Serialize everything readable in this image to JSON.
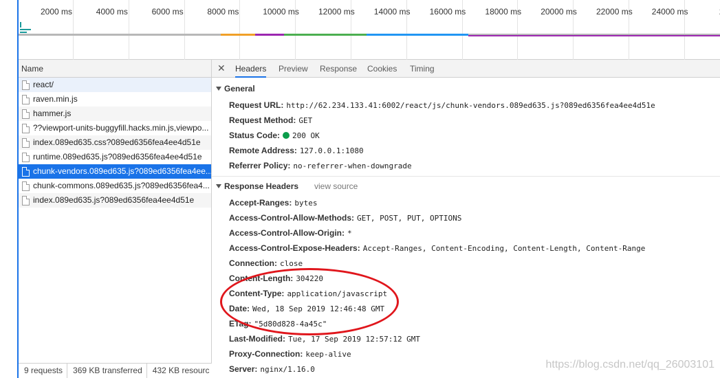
{
  "timeline": {
    "ticks": [
      "2000 ms",
      "4000 ms",
      "6000 ms",
      "8000 ms",
      "10000 ms",
      "12000 ms",
      "14000 ms",
      "16000 ms",
      "18000 ms",
      "20000 ms",
      "22000 ms",
      "24000 ms",
      "2600"
    ],
    "colors": {
      "gray": "#b8b8b8",
      "orange": "#f0a028",
      "purple": "#9c27b0",
      "green": "#4caf50",
      "blue": "#2196f3",
      "teal": "#1a9a9a"
    }
  },
  "name_panel": {
    "header": "Name",
    "rows": [
      "react/",
      "raven.min.js",
      "hammer.js",
      "??viewport-units-buggyfill.hacks.min.js,viewpo...",
      "index.089ed635.css?089ed6356fea4ee4d51e",
      "runtime.089ed635.js?089ed6356fea4ee4d51e",
      "chunk-vendors.089ed635.js?089ed6356fea4ee...",
      "chunk-commons.089ed635.js?089ed6356fea4...",
      "index.089ed635.js?089ed6356fea4ee4d51e"
    ],
    "selected_index": 6
  },
  "status": {
    "requests": "9 requests",
    "transferred": "369 KB transferred",
    "resources": "432 KB resourc"
  },
  "details": {
    "close_icon": "✕",
    "tabs": [
      "Headers",
      "Preview",
      "Response",
      "Cookies",
      "Timing"
    ],
    "active_tab": "Headers",
    "general": {
      "title": "General",
      "fields": [
        {
          "key": "Request URL:",
          "value": "http://62.234.133.41:6002/react/js/chunk-vendors.089ed635.js?089ed6356fea4ee4d51e"
        },
        {
          "key": "Request Method:",
          "value": "GET"
        },
        {
          "key": "Status Code:",
          "value": "200 OK"
        },
        {
          "key": "Remote Address:",
          "value": "127.0.0.1:1080"
        },
        {
          "key": "Referrer Policy:",
          "value": "no-referrer-when-downgrade"
        }
      ],
      "status_color": "#0a9d4b"
    },
    "response_headers": {
      "title": "Response Headers",
      "view_source": "view source",
      "fields": [
        {
          "key": "Accept-Ranges:",
          "value": "bytes"
        },
        {
          "key": "Access-Control-Allow-Methods:",
          "value": "GET, POST, PUT, OPTIONS"
        },
        {
          "key": "Access-Control-Allow-Origin:",
          "value": "*"
        },
        {
          "key": "Access-Control-Expose-Headers:",
          "value": "Accept-Ranges, Content-Encoding, Content-Length, Content-Range"
        },
        {
          "key": "Connection:",
          "value": "close"
        },
        {
          "key": "Content-Length:",
          "value": "304220"
        },
        {
          "key": "Content-Type:",
          "value": "application/javascript"
        },
        {
          "key": "Date:",
          "value": "Wed, 18 Sep 2019 12:46:48 GMT"
        },
        {
          "key": "ETag:",
          "value": "\"5d80d828-4a45c\""
        },
        {
          "key": "Last-Modified:",
          "value": "Tue, 17 Sep 2019 12:57:12 GMT"
        },
        {
          "key": "Proxy-Connection:",
          "value": "keep-alive"
        },
        {
          "key": "Server:",
          "value": "nginx/1.16.0"
        }
      ]
    }
  },
  "annotation_color": "#e0161c",
  "watermark": "https://blog.csdn.net/qq_26003101"
}
